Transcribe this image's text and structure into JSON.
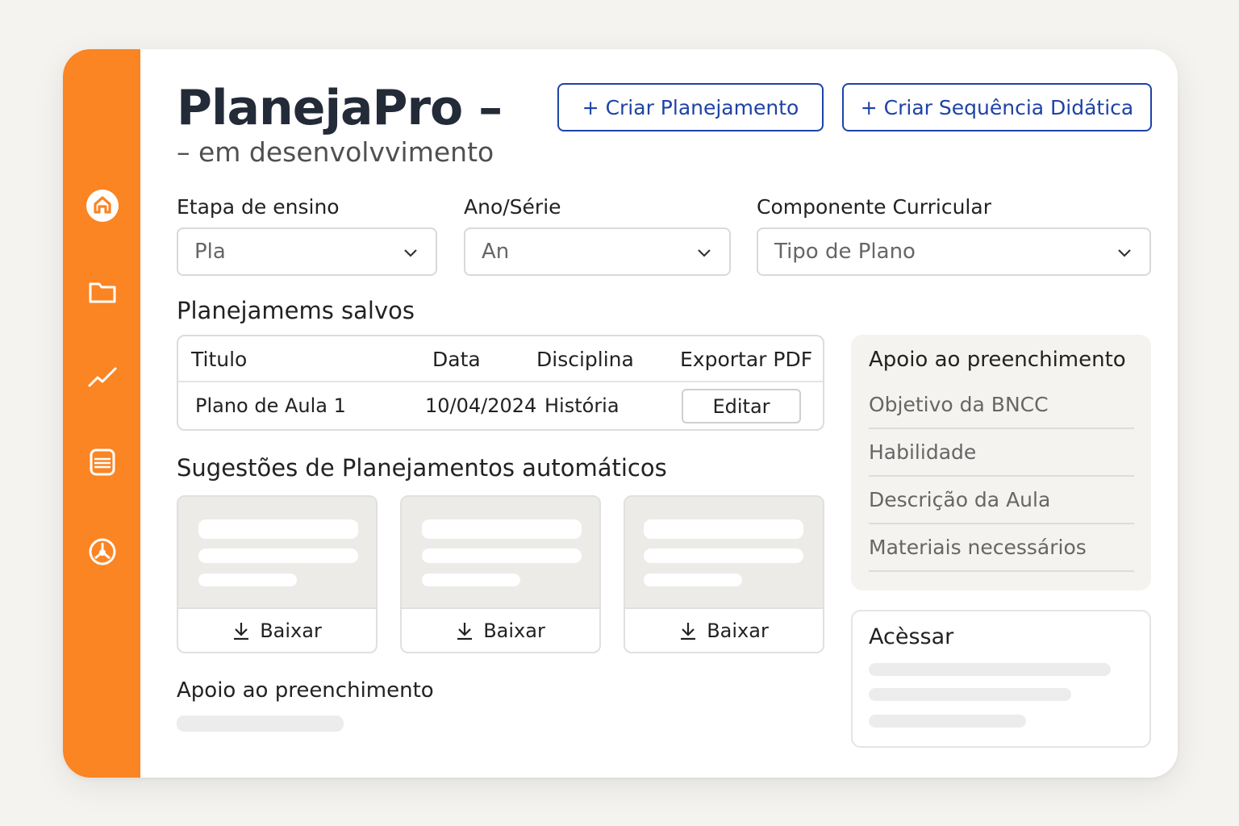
{
  "colors": {
    "sidebar": "#fb8423",
    "accent": "#1e43a6",
    "title": "#232a38"
  },
  "sidebar": {
    "icons": [
      {
        "name": "home-icon"
      },
      {
        "name": "folder-icon"
      },
      {
        "name": "trend-chart-icon"
      },
      {
        "name": "list-card-icon"
      },
      {
        "name": "settings-icon"
      }
    ]
  },
  "header": {
    "title": "PlanejaPro –",
    "subtitle": "– em desenvolvvimento",
    "buttons": {
      "create_plan": "+ Criar Planejamento",
      "create_sequence": "+ Criar Sequência Didática"
    }
  },
  "filters": {
    "stage": {
      "label": "Etapa de ensino",
      "value": "Pla"
    },
    "year": {
      "label": "Ano/Série",
      "value": "An"
    },
    "component": {
      "label": "Componente Curricular",
      "value": "Tipo de Plano"
    }
  },
  "saved": {
    "title": "Planejamems salvos",
    "columns": [
      "Titulo",
      "Data",
      "Disciplina",
      "Exportar PDF"
    ],
    "rows": [
      {
        "title": "Plano de Aula 1",
        "date": "10/04/2024",
        "discipline": "História",
        "action": "Editar"
      }
    ]
  },
  "suggestions": {
    "title": "Sugestões de Planejamentos automáticos",
    "cards": [
      {
        "action": "Baixar"
      },
      {
        "action": "Baixar"
      },
      {
        "action": "Baixar"
      }
    ]
  },
  "bottom_section": {
    "title": "Apoio ao preenchimento"
  },
  "support_panel": {
    "title": "Apoio ao preenchimento",
    "items": [
      "Objetivo da BNCC",
      "Habilidade",
      "Descrição da Aula",
      "Materiais necessários"
    ]
  },
  "access_panel": {
    "title": "Acèssar"
  }
}
